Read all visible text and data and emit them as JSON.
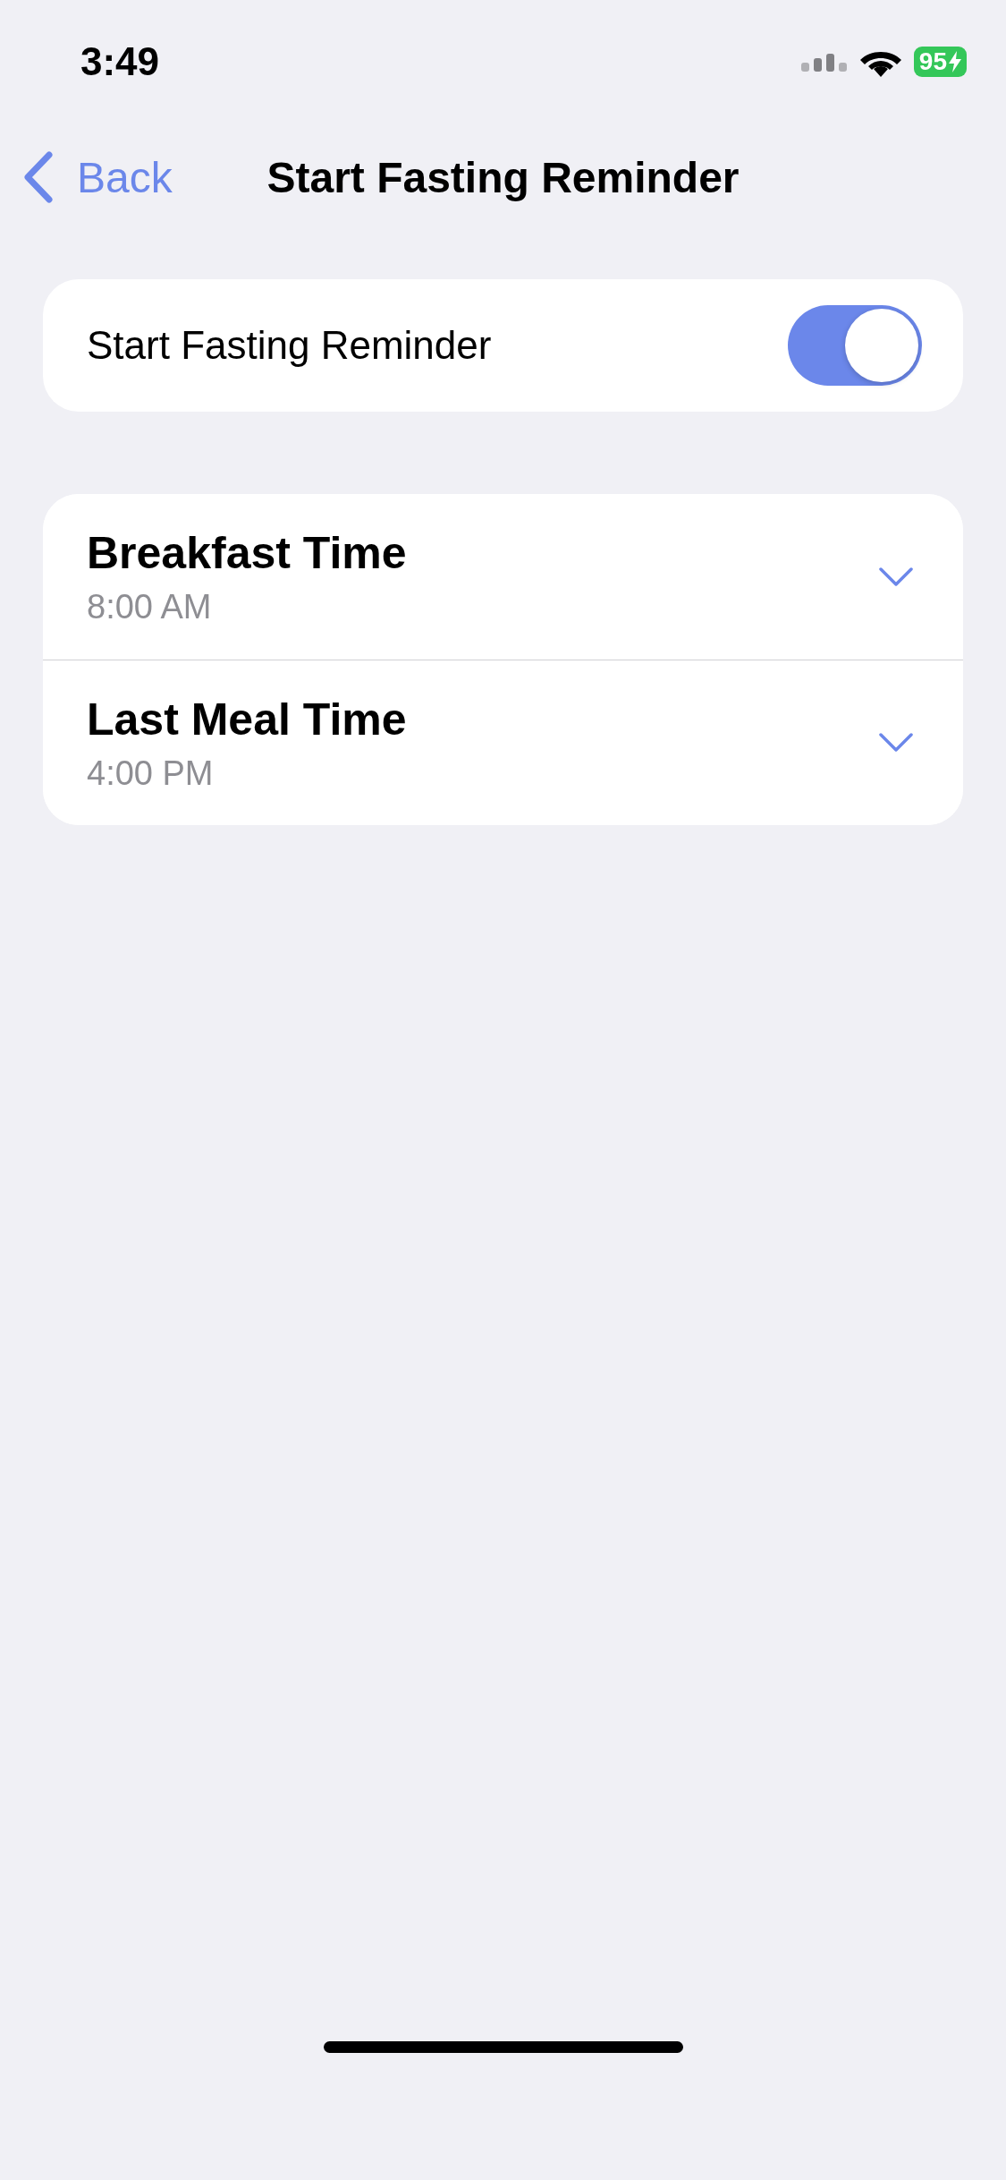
{
  "status_bar": {
    "time": "3:49",
    "battery": "95"
  },
  "nav": {
    "back": "Back",
    "title": "Start Fasting Reminder"
  },
  "reminder": {
    "label": "Start Fasting Reminder",
    "on": true
  },
  "times": [
    {
      "label": "Breakfast Time",
      "value": "8:00 AM",
      "expanded": false
    },
    {
      "label": "Last Meal Time",
      "value": "4:00 PM",
      "expanded": false
    }
  ]
}
